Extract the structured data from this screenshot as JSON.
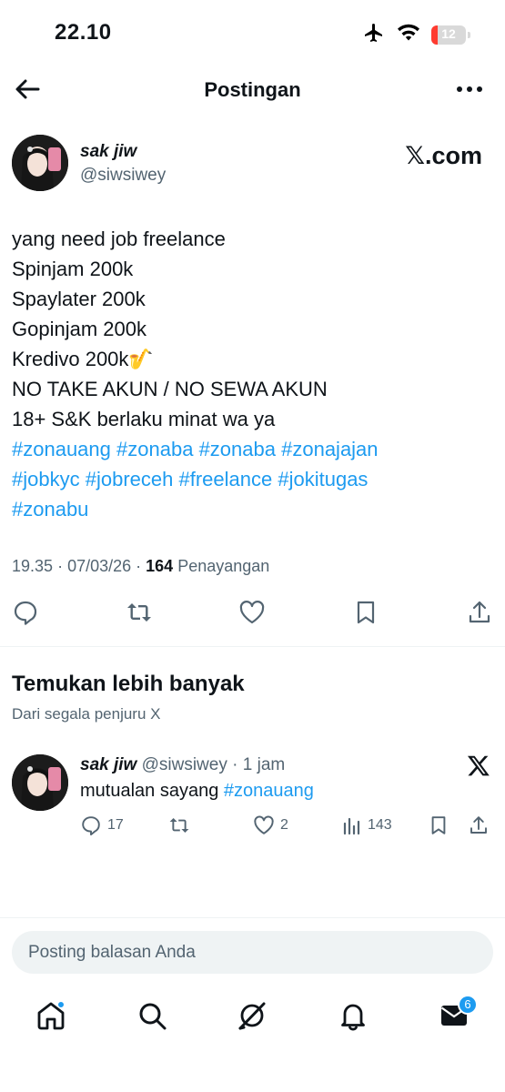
{
  "status_bar": {
    "time": "22.10",
    "battery": "12"
  },
  "header": {
    "title": "Postingan"
  },
  "post": {
    "author_name": "sak jiw",
    "author_handle": "@siwsiwey",
    "source": "𝕏.com",
    "lines": [
      "yang need job freelance",
      "Spinjam 200k",
      "Spaylater 200k",
      "Gopinjam 200k",
      "Kredivo 200k🎷",
      "NO TAKE AKUN / NO SEWA AKUN",
      "18+ S&K berlaku minat wa ya"
    ],
    "hashtag_lines": [
      [
        "#zonauang",
        "#zonaba",
        "#zonaba",
        "#zonajajan"
      ],
      [
        "#jobkyc",
        "#jobreceh",
        "#freelance",
        "#jokitugas"
      ],
      [
        "#zonabu"
      ]
    ],
    "time": "19.35",
    "date": "07/03/26",
    "views": "164",
    "views_label": "Penayangan"
  },
  "discover": {
    "title": "Temukan lebih banyak",
    "subtitle": "Dari segala penjuru X"
  },
  "related_post": {
    "author_name": "sak jiw",
    "author_handle": "@siwsiwey",
    "time": "1 jam",
    "text": "mutualan sayang",
    "hashtag": "#zonauang",
    "replies": "17",
    "likes": "2",
    "views": "143"
  },
  "reply": {
    "placeholder": "Posting balasan Anda"
  },
  "bottom_nav": {
    "items": [
      "home-icon",
      "search-icon",
      "grok-icon",
      "bell-icon",
      "mail-icon"
    ],
    "messages_badge": "6"
  },
  "colors": {
    "accent": "#1d9bf0",
    "text": "#0f1419",
    "secondary": "#536471",
    "divider": "#eff3f4",
    "battery_low": "#ff3b30"
  }
}
